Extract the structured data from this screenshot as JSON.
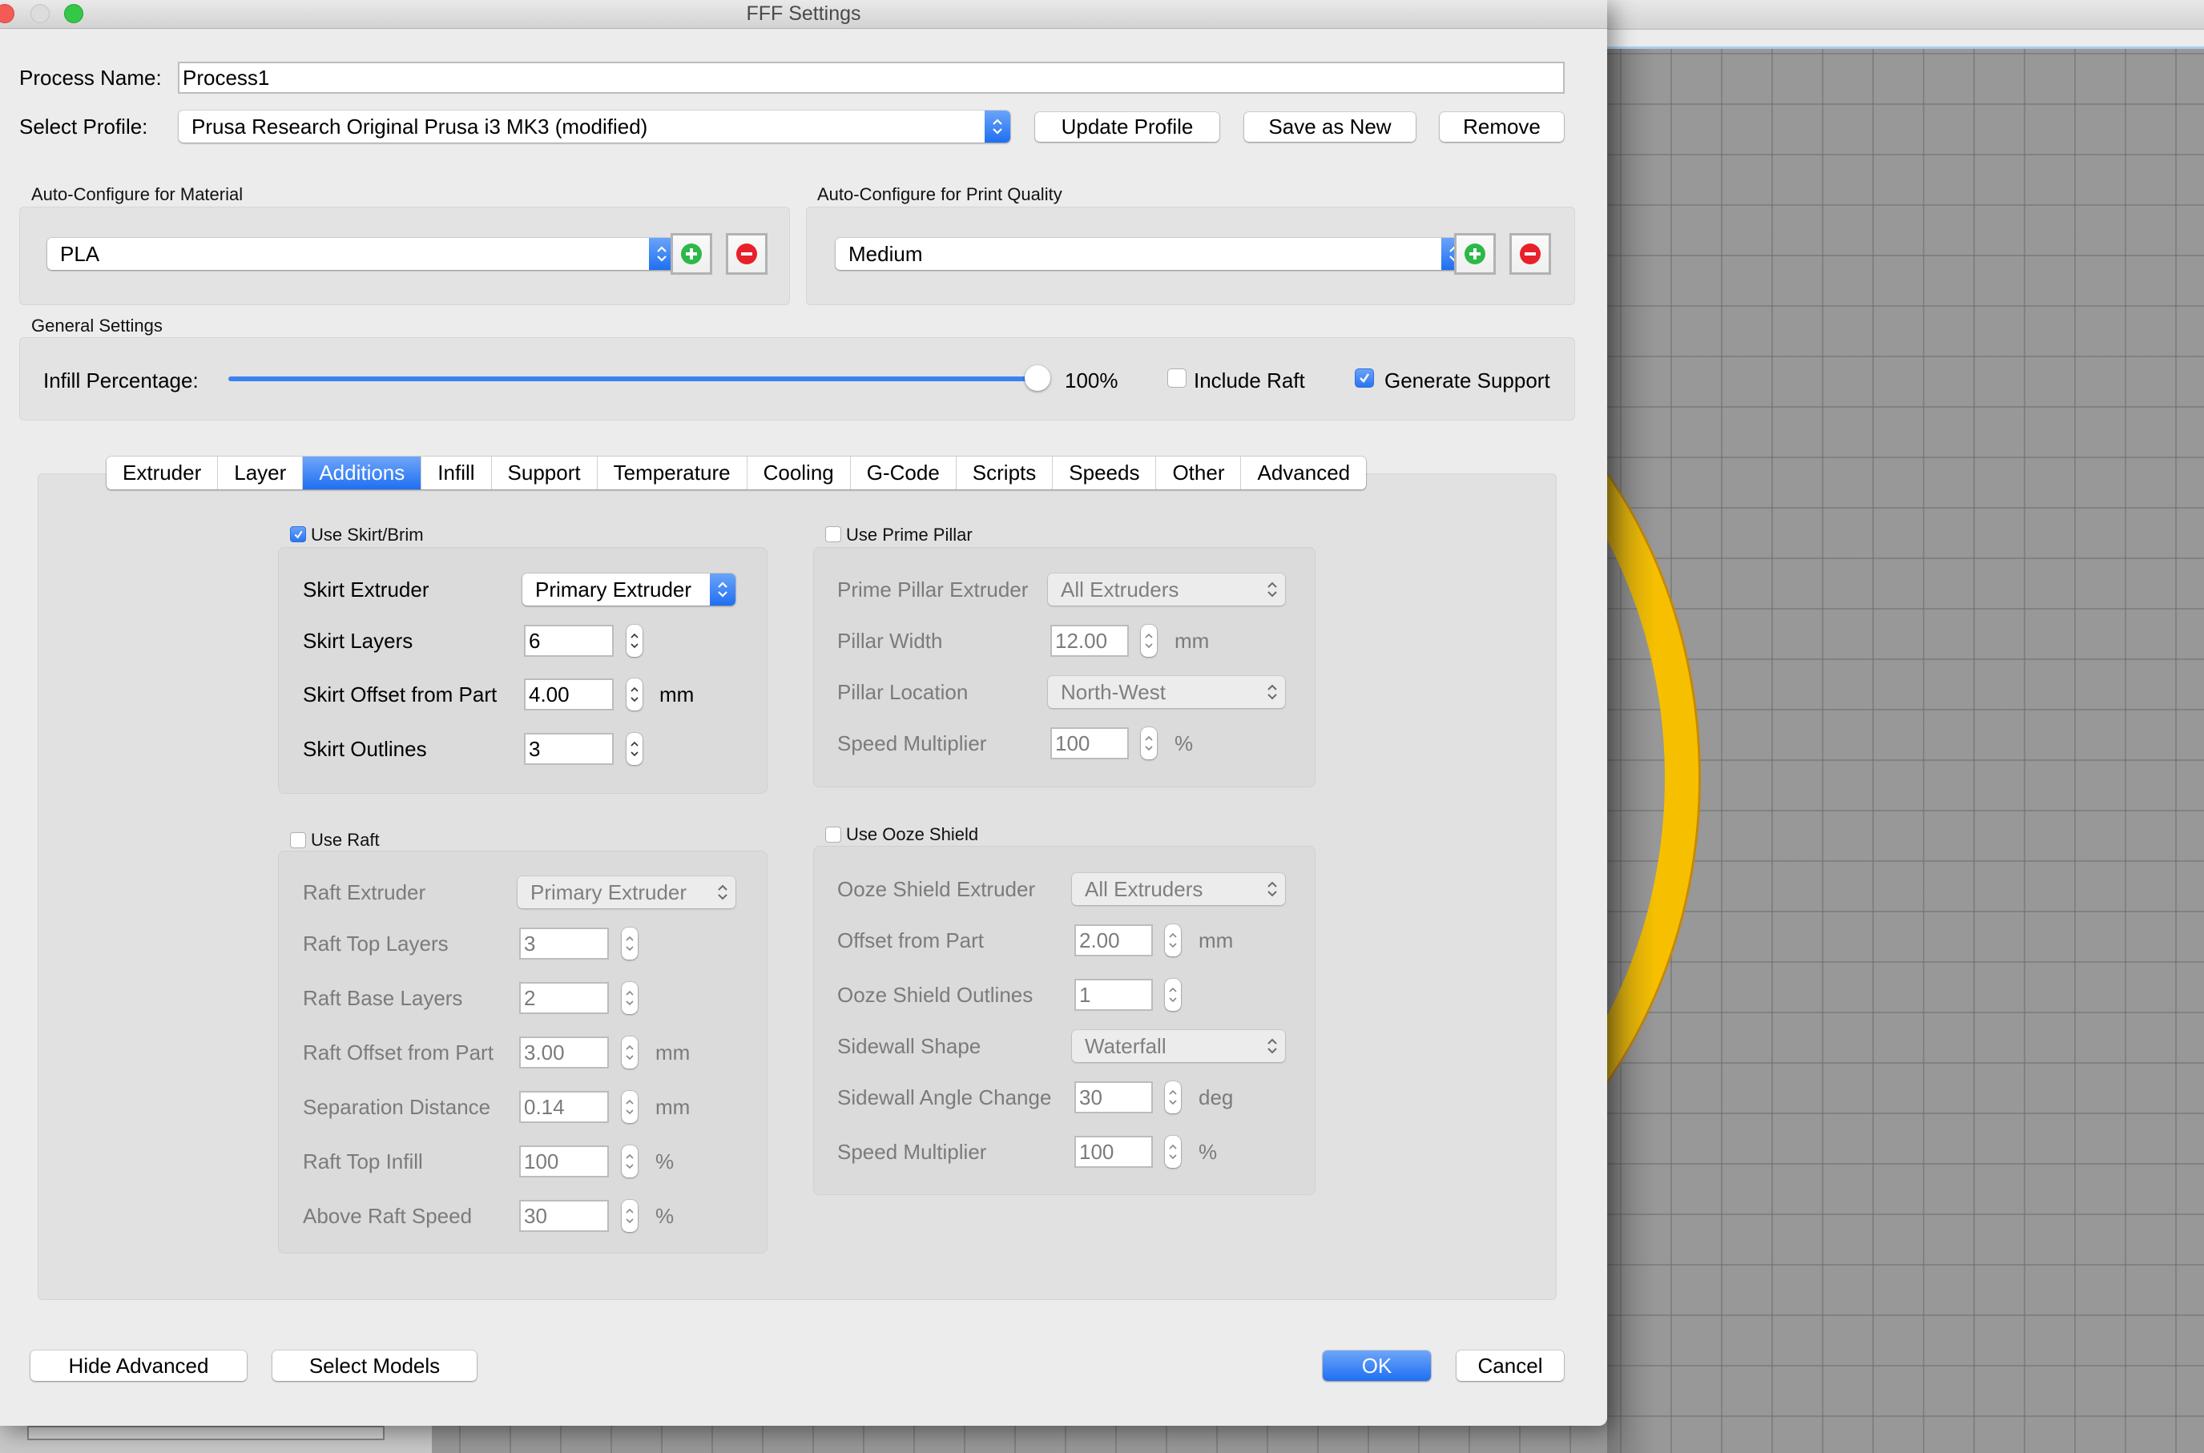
{
  "window": {
    "title": "FFF Settings"
  },
  "process_name": {
    "label": "Process Name:",
    "value": "Process1"
  },
  "profile": {
    "label": "Select Profile:",
    "value": "Prusa Research Original Prusa i3 MK3 (modified)",
    "update_button": "Update Profile",
    "save_as_new_button": "Save as New",
    "remove_button": "Remove"
  },
  "material": {
    "group_label": "Auto-Configure for Material",
    "value": "PLA",
    "add_icon": "plus-circle-icon",
    "remove_icon": "minus-circle-icon"
  },
  "quality": {
    "group_label": "Auto-Configure for Print Quality",
    "value": "Medium",
    "add_icon": "plus-circle-icon",
    "remove_icon": "minus-circle-icon"
  },
  "general": {
    "group_label": "General Settings",
    "infill_label": "Infill Percentage:",
    "infill_value": 100,
    "infill_text": "100%",
    "include_raft_label": "Include Raft",
    "include_raft_checked": false,
    "generate_support_label": "Generate Support",
    "generate_support_checked": true
  },
  "tabs": [
    {
      "label": "Extruder",
      "active": false
    },
    {
      "label": "Layer",
      "active": false
    },
    {
      "label": "Additions",
      "active": true
    },
    {
      "label": "Infill",
      "active": false
    },
    {
      "label": "Support",
      "active": false
    },
    {
      "label": "Temperature",
      "active": false
    },
    {
      "label": "Cooling",
      "active": false
    },
    {
      "label": "G-Code",
      "active": false
    },
    {
      "label": "Scripts",
      "active": false
    },
    {
      "label": "Speeds",
      "active": false
    },
    {
      "label": "Other",
      "active": false
    },
    {
      "label": "Advanced",
      "active": false
    }
  ],
  "skirt": {
    "checkbox_label": "Use Skirt/Brim",
    "checked": true,
    "extruder_label": "Skirt Extruder",
    "extruder_value": "Primary Extruder",
    "layers_label": "Skirt Layers",
    "layers_value": "6",
    "offset_label": "Skirt Offset from Part",
    "offset_value": "4.00",
    "offset_unit": "mm",
    "outlines_label": "Skirt Outlines",
    "outlines_value": "3"
  },
  "prime_pillar": {
    "checkbox_label": "Use Prime Pillar",
    "checked": false,
    "extruder_label": "Prime Pillar Extruder",
    "extruder_value": "All Extruders",
    "width_label": "Pillar Width",
    "width_value": "12.00",
    "width_unit": "mm",
    "location_label": "Pillar Location",
    "location_value": "North-West",
    "speed_label": "Speed Multiplier",
    "speed_value": "100",
    "speed_unit": "%"
  },
  "raft": {
    "checkbox_label": "Use Raft",
    "checked": false,
    "extruder_label": "Raft Extruder",
    "extruder_value": "Primary Extruder",
    "top_layers_label": "Raft Top Layers",
    "top_layers_value": "3",
    "base_layers_label": "Raft Base Layers",
    "base_layers_value": "2",
    "offset_label": "Raft Offset from Part",
    "offset_value": "3.00",
    "offset_unit": "mm",
    "separation_label": "Separation Distance",
    "separation_value": "0.14",
    "separation_unit": "mm",
    "top_infill_label": "Raft Top Infill",
    "top_infill_value": "100",
    "top_infill_unit": "%",
    "above_speed_label": "Above Raft Speed",
    "above_speed_value": "30",
    "above_speed_unit": "%"
  },
  "ooze": {
    "checkbox_label": "Use Ooze Shield",
    "checked": false,
    "extruder_label": "Ooze Shield Extruder",
    "extruder_value": "All Extruders",
    "offset_label": "Offset from Part",
    "offset_value": "2.00",
    "offset_unit": "mm",
    "outlines_label": "Ooze Shield Outlines",
    "outlines_value": "1",
    "sidewall_shape_label": "Sidewall Shape",
    "sidewall_shape_value": "Waterfall",
    "angle_label": "Sidewall Angle Change",
    "angle_value": "30",
    "angle_unit": "deg",
    "speed_label": "Speed Multiplier",
    "speed_value": "100",
    "speed_unit": "%"
  },
  "footer": {
    "hide_advanced": "Hide Advanced",
    "select_models": "Select Models",
    "ok": "OK",
    "cancel": "Cancel"
  },
  "colors": {
    "accent": "#1f6ff3",
    "add_green": "#2db84a",
    "remove_red": "#e8202a",
    "model_yellow": "#f6c000"
  }
}
